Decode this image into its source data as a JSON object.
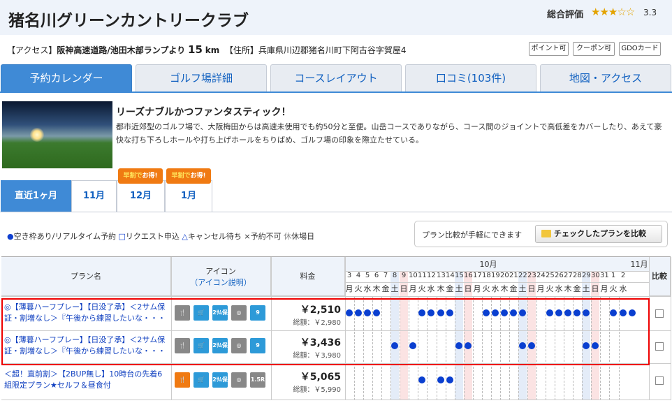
{
  "header": {
    "title": "猪名川グリーンカントリークラブ",
    "rating_label": "総合評価",
    "stars": "★★★☆☆",
    "rating_value": "3.3"
  },
  "info": {
    "access_label": "【アクセス】",
    "access_value": "阪神高速道路/池田木部ランプより",
    "distance": "15",
    "distance_unit": "km",
    "address_label": "【住所】",
    "address_value": "兵庫県川辺郡猪名川町下阿古谷字賀屋4"
  },
  "tags": [
    "ポイント可",
    "クーポン可",
    "GDOカード"
  ],
  "nav_tabs": [
    "予約カレンダー",
    "ゴルフ場詳細",
    "コースレイアウト",
    "口コミ(103件)",
    "地図・アクセス"
  ],
  "description": {
    "title": "リーズナブルかつファンタスティック！",
    "body": "都市近郊型のゴルフ場で、大阪梅田からは高速未使用でも約50分と至便。山岳コースでありながら、コース間のジョイントで高低差をカバーしたり、あえて豪快な打ち下ろしホールや打ち上げホールをちりばめ、ゴルフ場の印象を際立たせている。"
  },
  "month_tabs": [
    "直近1ヶ月",
    "11月",
    "12月",
    "1月"
  ],
  "badge": {
    "prefix": "早割で",
    "suffix": "お得!"
  },
  "legend": {
    "available": "●",
    "available_text": "空き枠あり/リアルタイム予約",
    "request": "□",
    "request_text": "リクエスト申込",
    "cancel": "△",
    "cancel_text": "キャンセル待ち",
    "unavailable": "×",
    "unavailable_text": "予約不可",
    "closed": "休",
    "closed_text": "休場日"
  },
  "compare": {
    "text": "プラン比較が手軽にできます",
    "button": "チェックしたプランを比較"
  },
  "table": {
    "col_plan": "プラン名",
    "col_icon": "アイコン",
    "col_icon_link": "（アイコン説明）",
    "col_price": "料金",
    "col_compare": "比較",
    "month_oct": "10月",
    "month_nov": "11月",
    "days": [
      "3",
      "4",
      "5",
      "6",
      "7",
      "8",
      "9",
      "10",
      "11",
      "12",
      "13",
      "14",
      "15",
      "16",
      "17",
      "18",
      "19",
      "20",
      "21",
      "22",
      "23",
      "24",
      "25",
      "26",
      "27",
      "28",
      "29",
      "30",
      "31",
      "1",
      "2"
    ],
    "weekdays": [
      "月",
      "火",
      "水",
      "木",
      "金",
      "土",
      "日",
      "月",
      "火",
      "水",
      "木",
      "金",
      "土",
      "日",
      "月",
      "火",
      "水",
      "木",
      "金",
      "土",
      "日",
      "月",
      "火",
      "水",
      "木",
      "金",
      "土",
      "日",
      "月",
      "火",
      "水"
    ],
    "rows": [
      {
        "plan_line1": "◎【薄暮ハーフプレー】【日没了承】＜2サム保",
        "plan_line2": "証・割増なし＞『午後から練習したいな・・・",
        "price": "￥2,510",
        "total": "総額：￥2,980",
        "icons": [
          "meal",
          "cart",
          "2sam",
          "player",
          "9hole"
        ],
        "availability": [
          1,
          1,
          1,
          1,
          0,
          0,
          0,
          0,
          1,
          1,
          1,
          1,
          0,
          0,
          0,
          1,
          1,
          1,
          1,
          1,
          0,
          0,
          1,
          1,
          1,
          1,
          1,
          0,
          0,
          1,
          1,
          1
        ]
      },
      {
        "plan_line1": "◎【薄暮ハーフプレー】【日没了承】＜2サム保",
        "plan_line2": "証・割増なし＞『午後から練習したいな・・・",
        "price": "￥3,436",
        "total": "総額：￥3,980",
        "icons": [
          "meal",
          "cart",
          "2sam",
          "player",
          "9hole"
        ],
        "availability": [
          0,
          0,
          0,
          0,
          0,
          1,
          0,
          1,
          0,
          0,
          0,
          0,
          1,
          1,
          0,
          0,
          0,
          0,
          0,
          1,
          1,
          0,
          0,
          0,
          0,
          0,
          1,
          1,
          0,
          0,
          0
        ]
      },
      {
        "plan_line1": "＜超！直前割＞【2BUP無し】10時台の先着6",
        "plan_line2": "組限定プラン★セルフ＆昼食付",
        "price": "￥5,065",
        "total": "総額：￥5,990",
        "icons": [
          "meal",
          "cart",
          "2sam",
          "player",
          "1.5R"
        ],
        "availability": [
          0,
          0,
          0,
          0,
          0,
          0,
          0,
          0,
          1,
          0,
          1,
          1,
          0,
          0,
          0,
          0,
          0,
          0,
          0,
          0,
          0,
          0,
          0,
          0,
          0,
          0,
          0,
          0,
          0,
          0,
          0
        ]
      }
    ],
    "icon_labels": {
      "2sam": "2サム保証",
      "9hole": "9",
      "r15": "1.5R"
    }
  },
  "colors": {
    "accent": "#3f8ad6",
    "link": "#1060c0",
    "highlight": "#e00000",
    "dot": "#0a3fd0",
    "badge": "#f07a12"
  }
}
